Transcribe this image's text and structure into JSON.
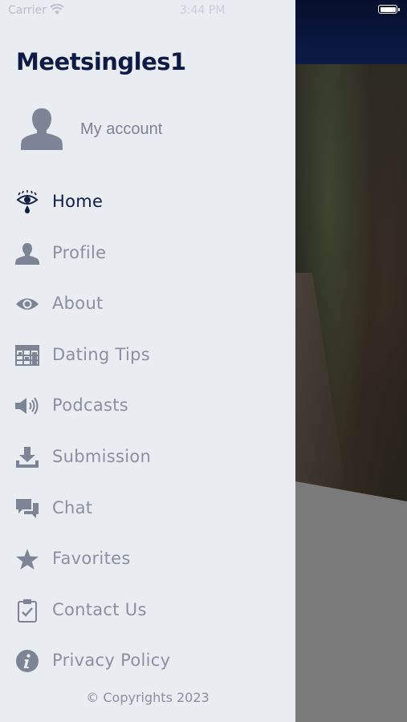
{
  "status_bar": {
    "carrier": "Carrier",
    "time": "3:44 PM"
  },
  "drawer": {
    "app_title": "Meetsingles1",
    "account_label": "My account",
    "menu": [
      {
        "label": "Home",
        "icon": "eye-tear-icon",
        "active": true
      },
      {
        "label": "Profile",
        "icon": "person-icon"
      },
      {
        "label": "About",
        "icon": "eye-icon"
      },
      {
        "label": "Dating Tips",
        "icon": "table-icon"
      },
      {
        "label": "Podcasts",
        "icon": "speaker-icon"
      },
      {
        "label": "Submission",
        "icon": "download-icon"
      },
      {
        "label": "Chat",
        "icon": "chat-bubbles-icon"
      },
      {
        "label": "Favorites",
        "icon": "star-icon"
      },
      {
        "label": "Contact Us",
        "icon": "clipboard-check-icon"
      },
      {
        "label": "Privacy Policy",
        "icon": "info-icon"
      }
    ],
    "copyright": "© Copyrights 2023"
  },
  "colors": {
    "drawer_bg": "#e9ecf1",
    "title": "#0f1b45",
    "active_label": "#121d47",
    "inactive_label": "#8a90a0",
    "icon": "#7d8496"
  }
}
